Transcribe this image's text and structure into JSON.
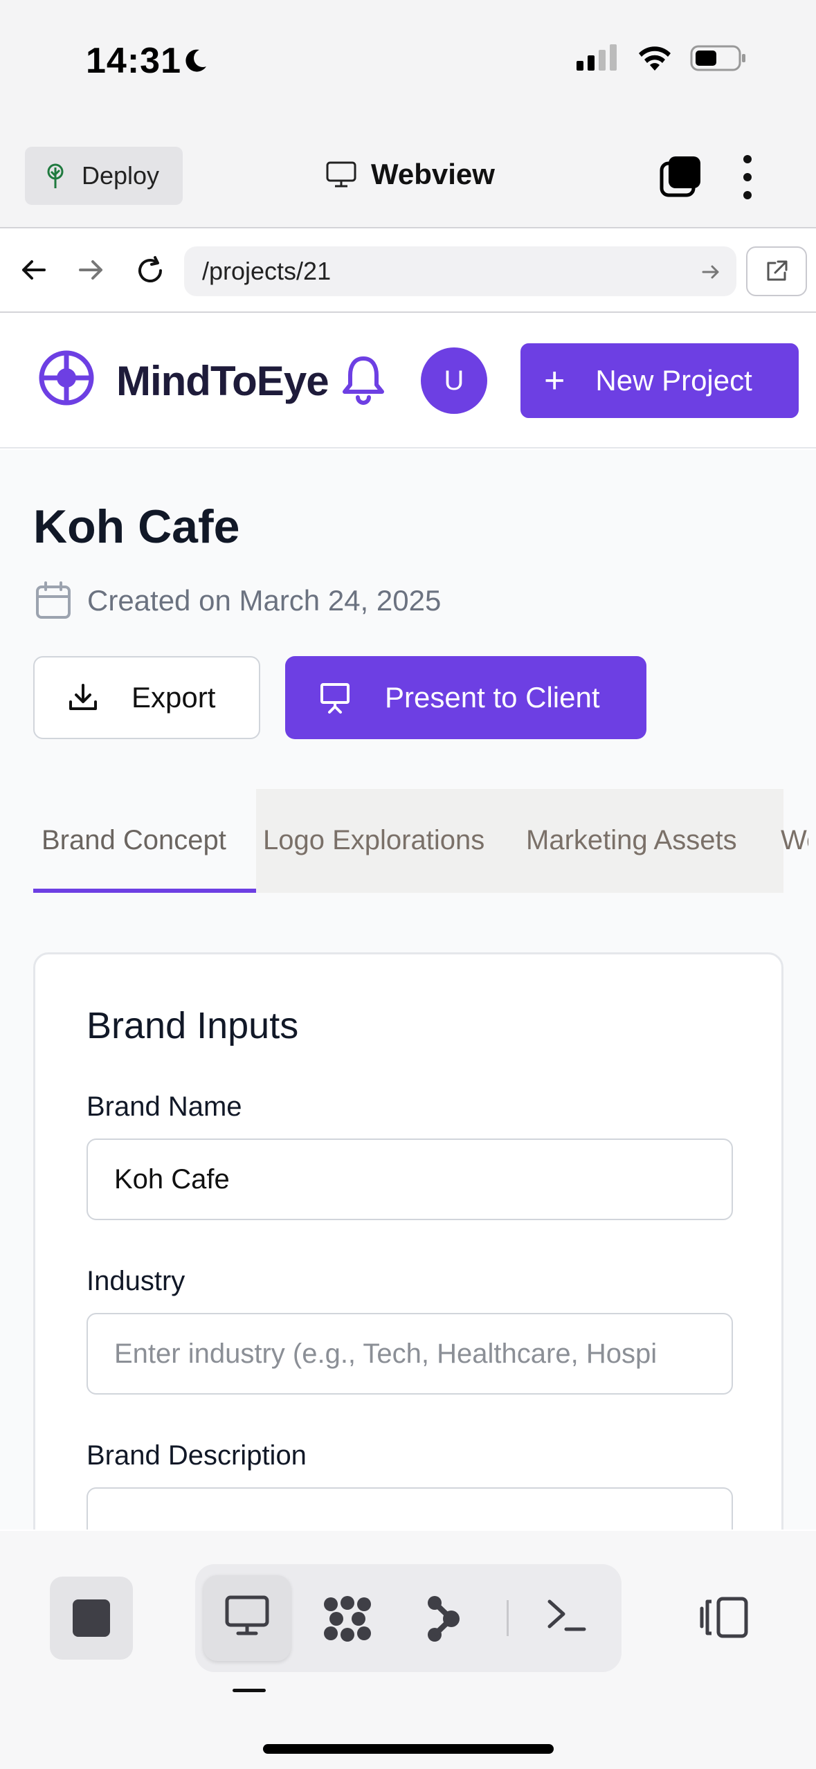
{
  "status_bar": {
    "time": "14:31"
  },
  "app_toolbar": {
    "deploy_label": "Deploy",
    "title": "Webview"
  },
  "url_bar": {
    "url": "/projects/21"
  },
  "header": {
    "brand": "MindToEye",
    "avatar_initial": "U",
    "new_project_label": "New Project"
  },
  "project": {
    "title": "Koh Cafe",
    "created": "Created on March 24, 2025",
    "export_label": "Export",
    "present_label": "Present to Client"
  },
  "tabs": [
    {
      "label": "Brand Concept",
      "active": true
    },
    {
      "label": "Logo Explorations",
      "active": false
    },
    {
      "label": "Marketing Assets",
      "active": false
    },
    {
      "label": "We",
      "active": false
    }
  ],
  "brand_inputs": {
    "title": "Brand Inputs",
    "brand_name_label": "Brand Name",
    "brand_name_value": "Koh Cafe",
    "industry_label": "Industry",
    "industry_placeholder": "Enter industry (e.g., Tech, Healthcare, Hospi",
    "description_label": "Brand Description"
  },
  "colors": {
    "accent": "#6d3fe3",
    "text_dark": "#111827",
    "muted": "#6b7280"
  }
}
